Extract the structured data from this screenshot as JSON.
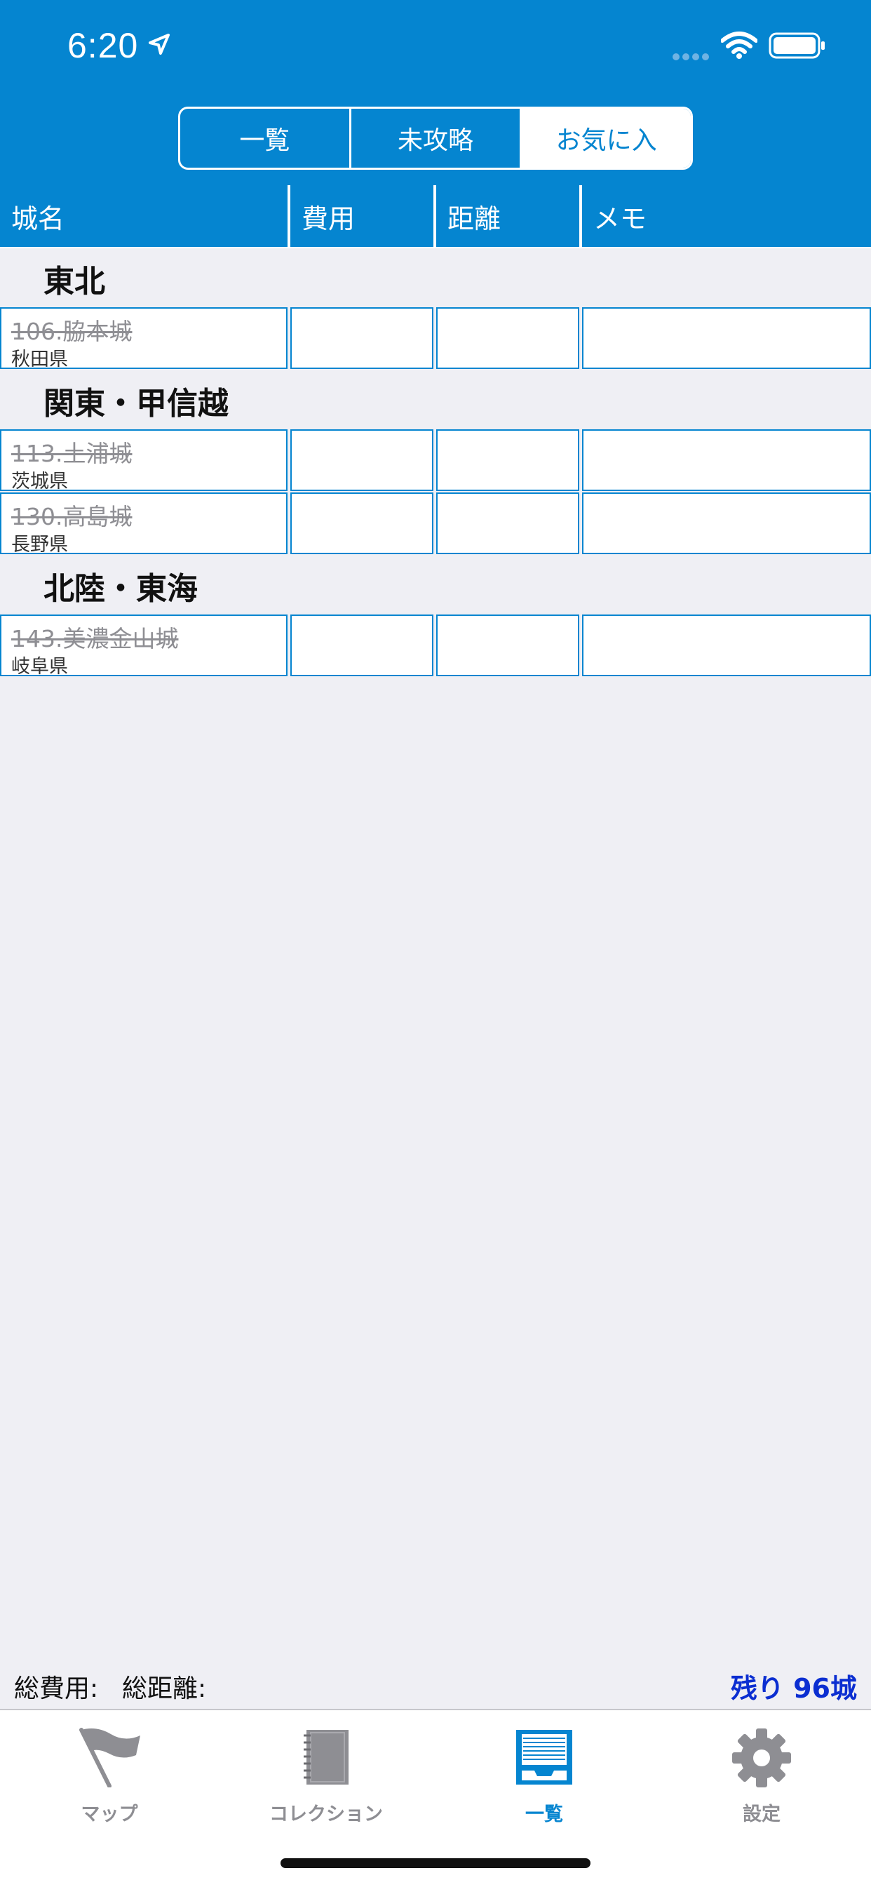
{
  "status": {
    "time": "6:20"
  },
  "segments": [
    {
      "label": "一覧",
      "active": false
    },
    {
      "label": "未攻略",
      "active": false
    },
    {
      "label": "お気に入",
      "active": true
    }
  ],
  "table": {
    "headers": [
      "城名",
      "費用",
      "距離",
      "メモ"
    ]
  },
  "sections": [
    {
      "title": "東北",
      "rows": [
        {
          "name": "106.脇本城",
          "prefecture": "秋田県"
        }
      ]
    },
    {
      "title": "関東・甲信越",
      "rows": [
        {
          "name": "113.土浦城",
          "prefecture": "茨城県"
        },
        {
          "name": "130.高島城",
          "prefecture": "長野県"
        }
      ]
    },
    {
      "title": "北陸・東海",
      "rows": [
        {
          "name": "143.美濃金山城",
          "prefecture": "岐阜県"
        }
      ]
    }
  ],
  "summary": {
    "total_cost_label": "総費用:",
    "total_distance_label": "総距離:",
    "remaining": "残り 96城"
  },
  "tabs": [
    {
      "label": "マップ",
      "icon": "flag-icon",
      "active": false
    },
    {
      "label": "コレクション",
      "icon": "notebook-icon",
      "active": false
    },
    {
      "label": "一覧",
      "icon": "list-icon",
      "active": true
    },
    {
      "label": "設定",
      "icon": "gear-icon",
      "active": false
    }
  ],
  "colors": {
    "brand": "#0585d0",
    "remaining": "#0b2ed1",
    "background": "#efeff4"
  }
}
